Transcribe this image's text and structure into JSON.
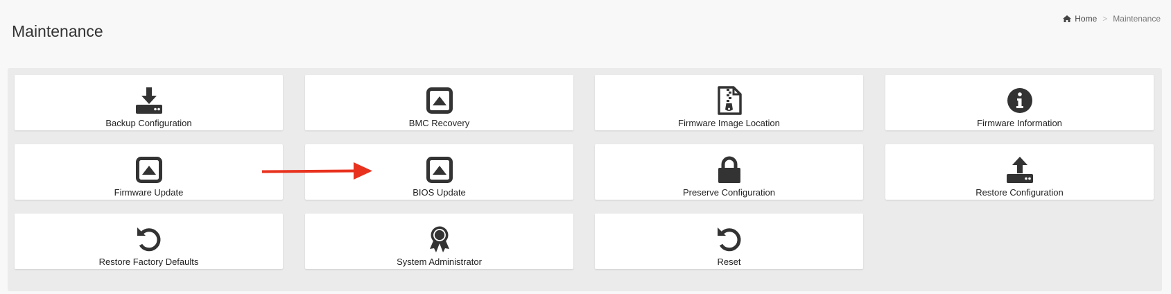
{
  "page": {
    "title": "Maintenance"
  },
  "breadcrumb": {
    "home": "Home",
    "separator": ">",
    "current": "Maintenance"
  },
  "colors": {
    "icon": "#333333",
    "annotation_arrow": "#e8321e"
  },
  "tiles": [
    {
      "label": "Backup Configuration",
      "icon": "download-icon"
    },
    {
      "label": "BMC Recovery",
      "icon": "caret-square-up-icon"
    },
    {
      "label": "Firmware Image Location",
      "icon": "file-zipper-icon"
    },
    {
      "label": "Firmware Information",
      "icon": "info-circle-icon"
    },
    {
      "label": "Firmware Update",
      "icon": "caret-square-up-icon"
    },
    {
      "label": "BIOS Update",
      "icon": "caret-square-up-icon"
    },
    {
      "label": "Preserve Configuration",
      "icon": "lock-icon"
    },
    {
      "label": "Restore Configuration",
      "icon": "upload-icon"
    },
    {
      "label": "Restore Factory Defaults",
      "icon": "undo-icon"
    },
    {
      "label": "System Administrator",
      "icon": "award-icon"
    },
    {
      "label": "Reset",
      "icon": "undo-icon"
    }
  ]
}
